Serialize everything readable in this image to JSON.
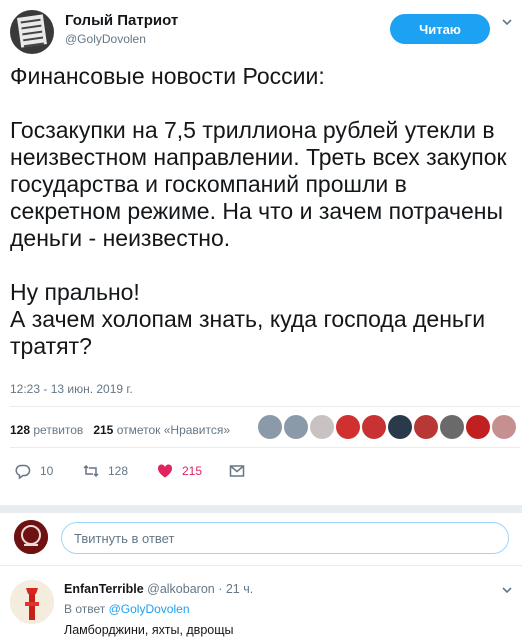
{
  "tweet": {
    "author_name": "Голый Патриот",
    "author_handle": "@GolyDovolen",
    "follow_label": "Читаю",
    "text": "Финансовые новости России:\n\nГосзакупки на 7,5 триллиона рублей утекли в неизвестном направлении. Треть всех закупок государства и госкомпаний прошли в секретном режиме. На что и зачем потрачены деньги - неизвестно.\n\nНу прально!\nА зачем холопам знать, куда господа деньги тратят?",
    "timestamp": "12:23 - 13 июн. 2019 г.",
    "retweets_count": "128",
    "retweets_label": "ретвитов",
    "likes_count": "215",
    "likes_label": "отметок «Нравится»",
    "likers_colors": [
      "#8a9aa8",
      "#8a9aa8",
      "#c9c2c2",
      "#d03030",
      "#c83232",
      "#2a3a4a",
      "#b83838",
      "#6a6a6a",
      "#c02020",
      "#c79090"
    ]
  },
  "actions": {
    "reply_count": "10",
    "retweet_count": "128",
    "like_count": "215",
    "like_color": "#e0245e"
  },
  "reply_box": {
    "placeholder": "Твитнуть в ответ"
  },
  "reply": {
    "author_name": "EnfanTerrible",
    "author_handle": "@alkobaron",
    "time": "· 21 ч.",
    "in_reply_prefix": "В ответ",
    "in_reply_mention": "@GolyDovolen",
    "text": "Ламборджини, яхты, дврощы"
  },
  "icons": [
    "chevron-down-icon",
    "reply-icon",
    "retweet-icon",
    "heart-icon",
    "message-icon"
  ]
}
